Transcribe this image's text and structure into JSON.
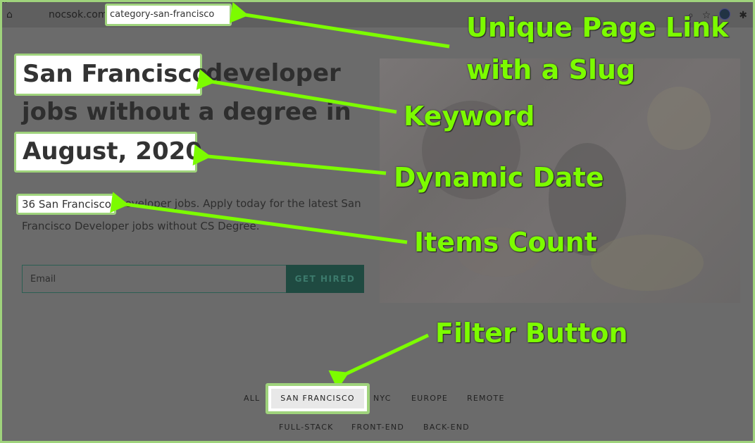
{
  "browser": {
    "url_domain": "nocsok.com/",
    "url_slug": "category-san-francisco"
  },
  "hero": {
    "title_keyword": "San Francisco",
    "title_rest": "developer",
    "title_line2": "jobs without a degree in",
    "title_date": "August, 2020",
    "desc_count": "36 San Francisco",
    "desc_rest": "Developer jobs. Apply today for the latest San",
    "desc_line2": "Francisco Developer jobs without CS Degree.",
    "email_placeholder": "Email",
    "cta_label": "GET HIRED"
  },
  "annotations": {
    "page_link_line1": "Unique Page Link",
    "page_link_line2": "with a Slug",
    "keyword": "Keyword",
    "dynamic_date": "Dynamic Date",
    "items_count": "Items Count",
    "filter_button": "Filter Button"
  },
  "filters": {
    "all": "ALL",
    "san_francisco": "SAN FRANCISCO",
    "nyc": "NYC",
    "europe": "EUROPE",
    "remote": "REMOTE",
    "full_stack": "FULL-STACK",
    "front_end": "FRONT-END",
    "back_end": "BACK-END"
  },
  "colors": {
    "annotation_green": "#7cfc00",
    "highlight_border": "#9fd37c",
    "cta_bg": "#1f4a41"
  },
  "icons": [
    "home-icon",
    "lock-icon",
    "zoom-icon",
    "star-icon",
    "avatar-icon",
    "extensions-icon"
  ]
}
